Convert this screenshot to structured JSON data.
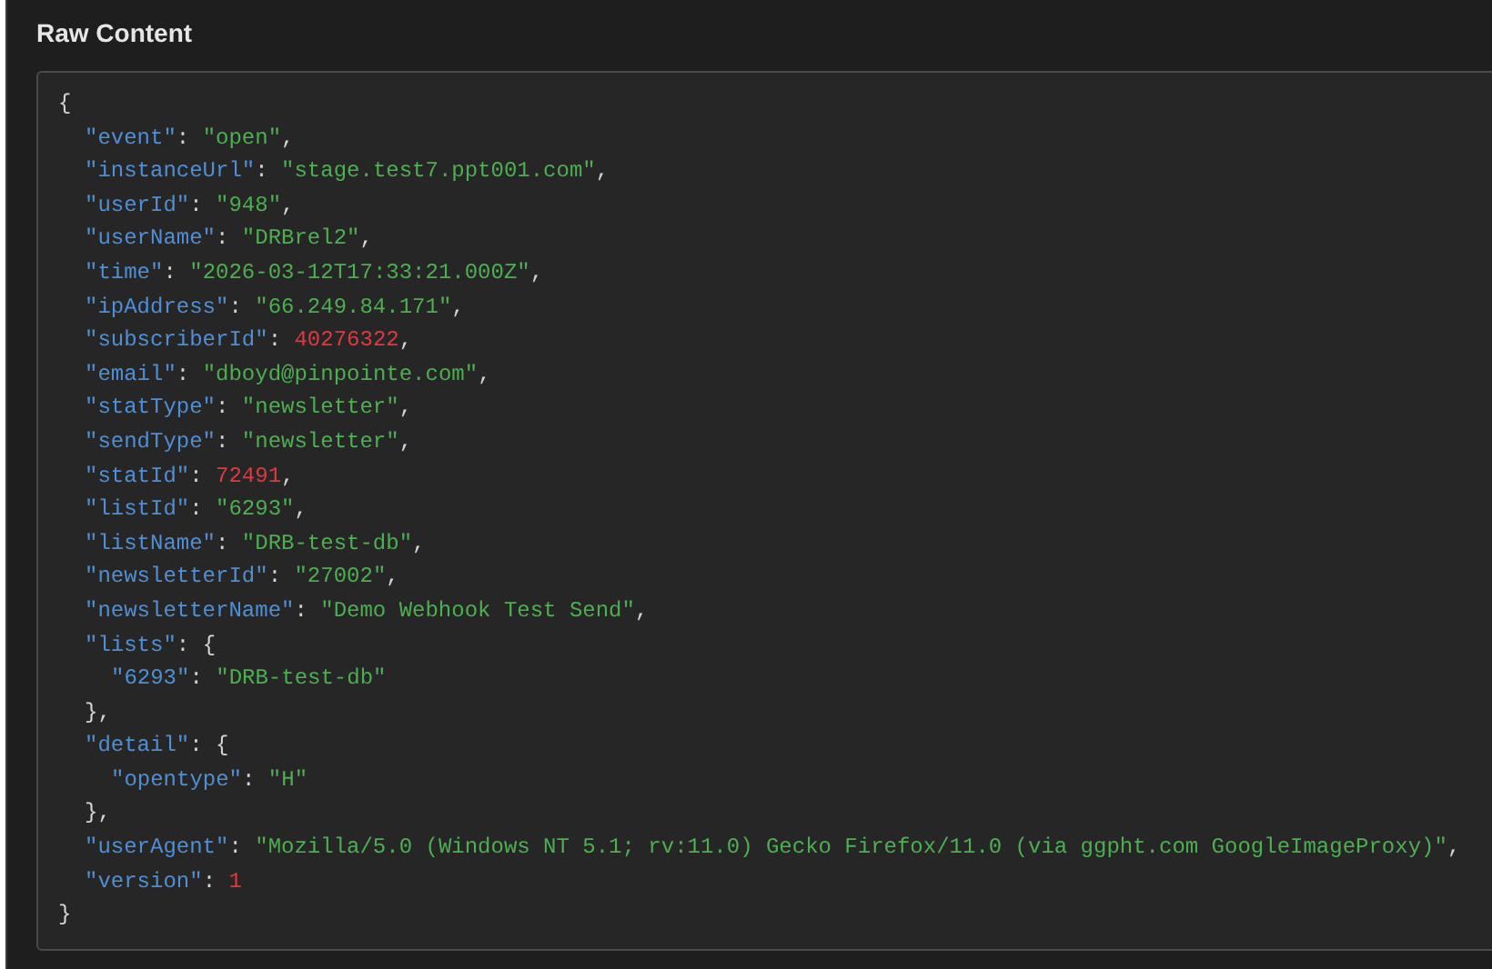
{
  "title": "Raw Content",
  "code": [
    {
      "tokens": [
        {
          "kind": "punct",
          "text": "{"
        }
      ],
      "children": [
        {
          "tokens": [
            {
              "kind": "key",
              "text": "\"event\""
            },
            {
              "kind": "punct",
              "text": ": "
            },
            {
              "kind": "string",
              "text": "\"open\""
            },
            {
              "kind": "punct",
              "text": ","
            }
          ]
        },
        {
          "tokens": [
            {
              "kind": "key",
              "text": "\"instanceUrl\""
            },
            {
              "kind": "punct",
              "text": ": "
            },
            {
              "kind": "string",
              "text": "\"stage.test7.ppt001.com\""
            },
            {
              "kind": "punct",
              "text": ","
            }
          ]
        },
        {
          "tokens": [
            {
              "kind": "key",
              "text": "\"userId\""
            },
            {
              "kind": "punct",
              "text": ": "
            },
            {
              "kind": "string",
              "text": "\"948\""
            },
            {
              "kind": "punct",
              "text": ","
            }
          ]
        },
        {
          "tokens": [
            {
              "kind": "key",
              "text": "\"userName\""
            },
            {
              "kind": "punct",
              "text": ": "
            },
            {
              "kind": "string",
              "text": "\"DRBrel2\""
            },
            {
              "kind": "punct",
              "text": ","
            }
          ]
        },
        {
          "tokens": [
            {
              "kind": "key",
              "text": "\"time\""
            },
            {
              "kind": "punct",
              "text": ": "
            },
            {
              "kind": "string",
              "text": "\"2026-03-12T17:33:21.000Z\""
            },
            {
              "kind": "punct",
              "text": ","
            }
          ]
        },
        {
          "tokens": [
            {
              "kind": "key",
              "text": "\"ipAddress\""
            },
            {
              "kind": "punct",
              "text": ": "
            },
            {
              "kind": "string",
              "text": "\"66.249.84.171\""
            },
            {
              "kind": "punct",
              "text": ","
            }
          ]
        },
        {
          "tokens": [
            {
              "kind": "key",
              "text": "\"subscriberId\""
            },
            {
              "kind": "punct",
              "text": ": "
            },
            {
              "kind": "number",
              "text": "40276322"
            },
            {
              "kind": "punct",
              "text": ","
            }
          ]
        },
        {
          "tokens": [
            {
              "kind": "key",
              "text": "\"email\""
            },
            {
              "kind": "punct",
              "text": ": "
            },
            {
              "kind": "string",
              "text": "\"dboyd@pinpointe.com\""
            },
            {
              "kind": "punct",
              "text": ","
            }
          ]
        },
        {
          "tokens": [
            {
              "kind": "key",
              "text": "\"statType\""
            },
            {
              "kind": "punct",
              "text": ": "
            },
            {
              "kind": "string",
              "text": "\"newsletter\""
            },
            {
              "kind": "punct",
              "text": ","
            }
          ]
        },
        {
          "tokens": [
            {
              "kind": "key",
              "text": "\"sendType\""
            },
            {
              "kind": "punct",
              "text": ": "
            },
            {
              "kind": "string",
              "text": "\"newsletter\""
            },
            {
              "kind": "punct",
              "text": ","
            }
          ]
        },
        {
          "tokens": [
            {
              "kind": "key",
              "text": "\"statId\""
            },
            {
              "kind": "punct",
              "text": ": "
            },
            {
              "kind": "number",
              "text": "72491"
            },
            {
              "kind": "punct",
              "text": ","
            }
          ]
        },
        {
          "tokens": [
            {
              "kind": "key",
              "text": "\"listId\""
            },
            {
              "kind": "punct",
              "text": ": "
            },
            {
              "kind": "string",
              "text": "\"6293\""
            },
            {
              "kind": "punct",
              "text": ","
            }
          ]
        },
        {
          "tokens": [
            {
              "kind": "key",
              "text": "\"listName\""
            },
            {
              "kind": "punct",
              "text": ": "
            },
            {
              "kind": "string",
              "text": "\"DRB-test-db\""
            },
            {
              "kind": "punct",
              "text": ","
            }
          ]
        },
        {
          "tokens": [
            {
              "kind": "key",
              "text": "\"newsletterId\""
            },
            {
              "kind": "punct",
              "text": ": "
            },
            {
              "kind": "string",
              "text": "\"27002\""
            },
            {
              "kind": "punct",
              "text": ","
            }
          ]
        },
        {
          "tokens": [
            {
              "kind": "key",
              "text": "\"newsletterName\""
            },
            {
              "kind": "punct",
              "text": ": "
            },
            {
              "kind": "string",
              "text": "\"Demo Webhook Test Send\""
            },
            {
              "kind": "punct",
              "text": ","
            }
          ]
        },
        {
          "tokens": [
            {
              "kind": "key",
              "text": "\"lists\""
            },
            {
              "kind": "punct",
              "text": ": {"
            }
          ],
          "children": [
            {
              "tokens": [
                {
                  "kind": "key",
                  "text": "\"6293\""
                },
                {
                  "kind": "punct",
                  "text": ": "
                },
                {
                  "kind": "string",
                  "text": "\"DRB-test-db\""
                }
              ]
            }
          ]
        },
        {
          "tokens": [
            {
              "kind": "punct",
              "text": "},"
            }
          ]
        },
        {
          "tokens": [
            {
              "kind": "key",
              "text": "\"detail\""
            },
            {
              "kind": "punct",
              "text": ": {"
            }
          ],
          "children": [
            {
              "tokens": [
                {
                  "kind": "key",
                  "text": "\"opentype\""
                },
                {
                  "kind": "punct",
                  "text": ": "
                },
                {
                  "kind": "string",
                  "text": "\"H\""
                }
              ]
            }
          ]
        },
        {
          "tokens": [
            {
              "kind": "punct",
              "text": "},"
            }
          ]
        },
        {
          "tokens": [
            {
              "kind": "key",
              "text": "\"userAgent\""
            },
            {
              "kind": "punct",
              "text": ": "
            },
            {
              "kind": "string",
              "text": "\"Mozilla/5.0 (Windows NT 5.1; rv:11.0) Gecko Firefox/11.0 (via ggpht.com GoogleImageProxy)\""
            },
            {
              "kind": "punct",
              "text": ","
            }
          ]
        },
        {
          "tokens": [
            {
              "kind": "key",
              "text": "\"version\""
            },
            {
              "kind": "punct",
              "text": ": "
            },
            {
              "kind": "number",
              "text": "1"
            }
          ]
        }
      ]
    },
    {
      "tokens": [
        {
          "kind": "punct",
          "text": "}"
        }
      ]
    }
  ]
}
